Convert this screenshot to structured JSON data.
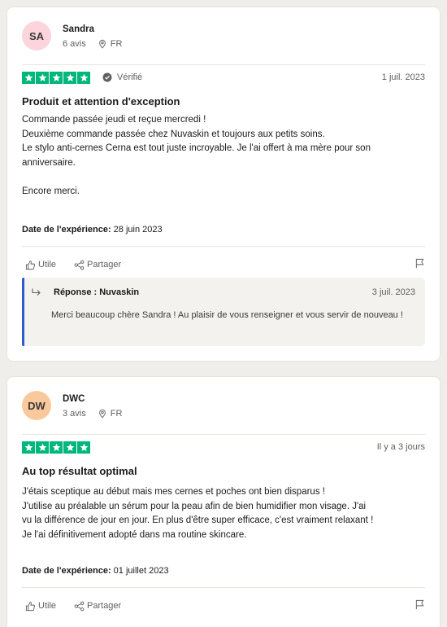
{
  "colors": {
    "trustpilot_green": "#00b67a",
    "reply_accent": "#2b5ec8",
    "avatar_sa": "#fbd4dc",
    "avatar_dw": "#f9c99b"
  },
  "reviews": [
    {
      "avatar_initials": "SA",
      "name": "Sandra",
      "review_count": "6 avis",
      "country": "FR",
      "stars": 5,
      "verified_label": "Vérifié",
      "date": "1 juil. 2023",
      "title": "Produit et attention d'exception",
      "body": [
        "Commande passée jeudi et reçue mercredi !",
        "Deuxième commande passée chez Nuvaskin et toujours aux petits soins.",
        "Le stylo anti-cernes Cerna est tout juste incroyable. Je l'ai offert à ma mère pour son",
        "anniversaire.",
        "",
        "Encore merci."
      ],
      "experience_label": "Date de l'expérience:",
      "experience_date": "28 juin 2023",
      "useful_label": "Utile",
      "share_label": "Partager",
      "reply": {
        "title": "Réponse : Nuvaskin",
        "date": "3 juil. 2023",
        "text": "Merci beaucoup chère Sandra ! Au plaisir de vous renseigner et vous servir de nouveau !"
      }
    },
    {
      "avatar_initials": "DW",
      "name": "DWC",
      "review_count": "3 avis",
      "country": "FR",
      "stars": 5,
      "date": "Il y a 3 jours",
      "title": "Au top résultat optimal",
      "body": [
        "J'étais sceptique au début mais mes cernes et poches ont bien disparus !",
        "J'utilise au préalable un sérum pour la peau afin de bien humidifier mon visage. J'ai",
        "vu la différence de jour en jour. En plus d'être super efficace, c'est vraiment relaxant !",
        "Je l'ai définitivement adopté dans ma routine skincare."
      ],
      "experience_label": "Date de l'expérience:",
      "experience_date": "01 juillet 2023",
      "useful_label": "Utile",
      "share_label": "Partager"
    }
  ]
}
